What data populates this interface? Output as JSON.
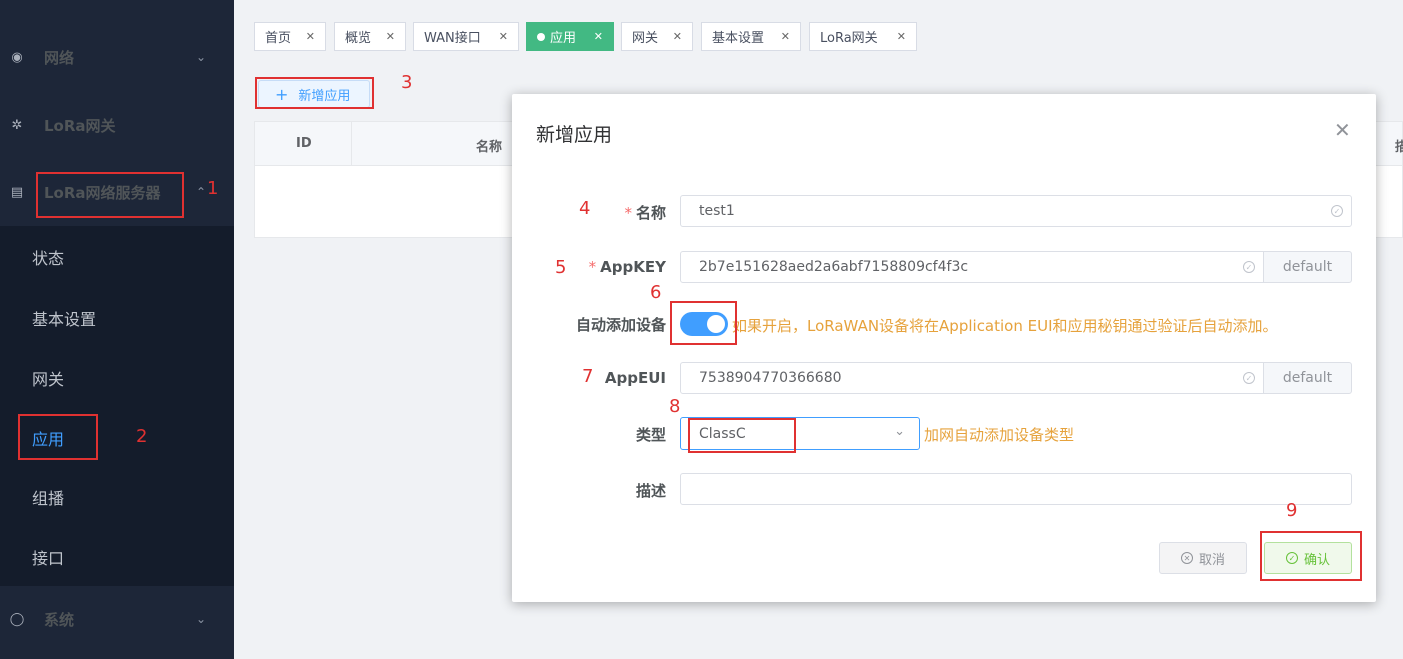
{
  "sidebar": {
    "menus": [
      {
        "label": "网络",
        "icon": "network-icon"
      },
      {
        "label": "LoRa网关",
        "icon": "antenna-icon"
      },
      {
        "label": "LoRa网络服务器",
        "icon": "server-icon"
      },
      {
        "label": "系统",
        "icon": "system-icon"
      }
    ],
    "submenu": [
      "状态",
      "基本设置",
      "网关",
      "应用",
      "组播",
      "接口"
    ]
  },
  "tabs": [
    {
      "label": "首页"
    },
    {
      "label": "概览"
    },
    {
      "label": "WAN接口"
    },
    {
      "label": "应用",
      "active": true
    },
    {
      "label": "网关"
    },
    {
      "label": "基本设置"
    },
    {
      "label": "LoRa网关"
    }
  ],
  "toolbar": {
    "add_label": "新增应用"
  },
  "table": {
    "headers": [
      "ID",
      "名称",
      "描"
    ]
  },
  "annotations": [
    "1",
    "2",
    "3",
    "4",
    "5",
    "6",
    "7",
    "8",
    "9"
  ],
  "dialog": {
    "title": "新增应用",
    "fields": {
      "name": {
        "label": "名称",
        "value": "test1",
        "required": true
      },
      "appkey": {
        "label": "AppKEY",
        "value": "2b7e151628aed2a6abf7158809cf4f3c",
        "append": "default",
        "required": true
      },
      "autoadd": {
        "label": "自动添加设备",
        "enabled": true,
        "hint": "如果开启，LoRaWAN设备将在Application EUI和应用秘钥通过验证后自动添加。"
      },
      "appeui": {
        "label": "AppEUI",
        "value": "7538904770366680",
        "append": "default"
      },
      "type": {
        "label": "类型",
        "value": "ClassC",
        "hint": "加网自动添加设备类型"
      },
      "desc": {
        "label": "描述",
        "value": ""
      }
    },
    "cancel_label": "取消",
    "confirm_label": "确认"
  },
  "colors": {
    "primary": "#409eff",
    "success": "#67c23a",
    "warning": "#e6a23c",
    "annotation": "#e03131",
    "sidebar": "#1d2638"
  }
}
